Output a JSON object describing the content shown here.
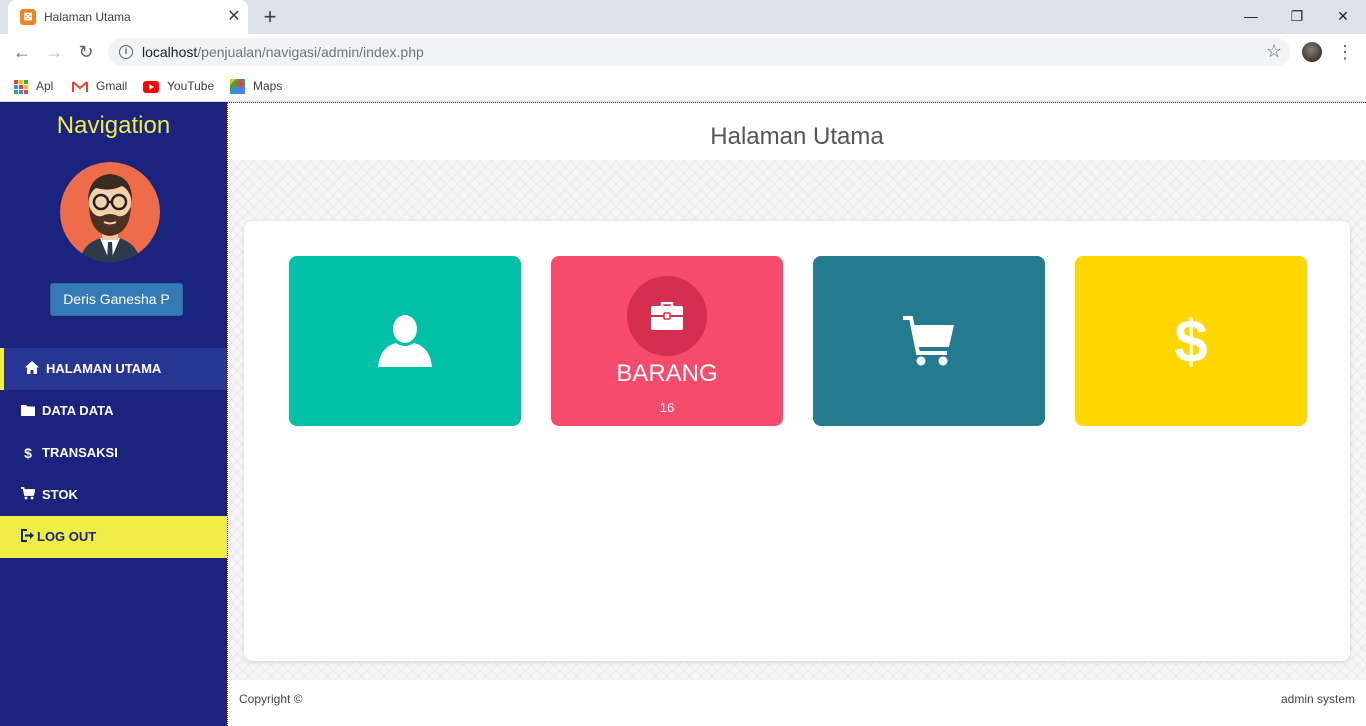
{
  "browser": {
    "tab_title": "Halaman Utama",
    "url_host": "localhost",
    "url_path": "/penjualan/navigasi/admin/index.php",
    "bookmarks": [
      "Apl",
      "Gmail",
      "YouTube",
      "Maps"
    ]
  },
  "sidebar": {
    "title": "Navigation",
    "user_name": "Deris Ganesha P",
    "items": [
      {
        "label": "HALAMAN UTAMA",
        "icon": "home-icon"
      },
      {
        "label": "DATA DATA",
        "icon": "folder-icon"
      },
      {
        "label": "TRANSAKSI",
        "icon": "dollar-icon"
      },
      {
        "label": "STOK",
        "icon": "cart-icon"
      },
      {
        "label": "LOG OUT",
        "icon": "sign-out-icon"
      }
    ]
  },
  "main": {
    "title": "Halaman Utama",
    "tiles": [
      {
        "icon": "user-icon",
        "color": "#00c0a8"
      },
      {
        "icon": "briefcase-icon",
        "color": "#f64b6b",
        "label": "BARANG",
        "value": "16"
      },
      {
        "icon": "cart-icon",
        "color": "#247a8f"
      },
      {
        "icon": "dollar-icon",
        "color": "#ffd600"
      }
    ]
  },
  "footer": {
    "left": "Copyright ©",
    "right": "admin system"
  },
  "colors": {
    "sidebar": "#1a237e",
    "accent": "#eeee44",
    "user_button": "#337ab7"
  }
}
